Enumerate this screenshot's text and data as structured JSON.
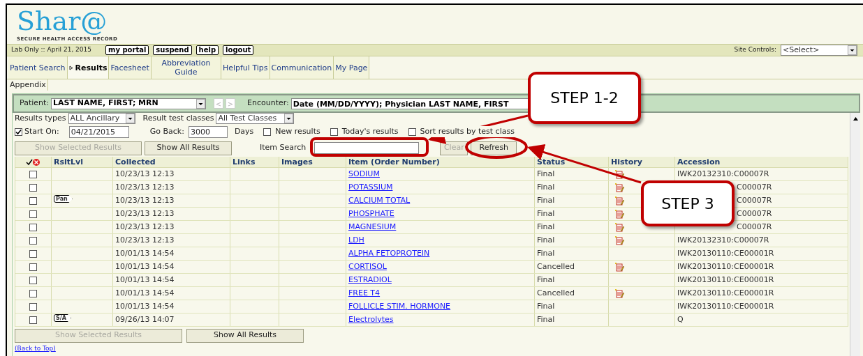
{
  "logo": {
    "title": "Shar@",
    "subtitle": "SECURE HEALTH ACCESS RECORD"
  },
  "top_bar": {
    "context": "Lab Only :: April 21, 2015",
    "buttons": [
      "my portal",
      "suspend",
      "help",
      "logout"
    ],
    "site_controls_label": "Site Controls:",
    "site_controls_value": "<Select>"
  },
  "tabs": [
    {
      "label": "Patient Search",
      "selected": false
    },
    {
      "label": "Results",
      "selected": true
    },
    {
      "label": "Facesheet",
      "selected": false
    },
    {
      "label": "Abbreviation Guide",
      "selected": false
    },
    {
      "label": "Helpful Tips",
      "selected": false
    },
    {
      "label": "Communication",
      "selected": false
    },
    {
      "label": "My Page",
      "selected": false
    }
  ],
  "tabs_row_2": [
    {
      "label": "Appendix",
      "selected": false
    }
  ],
  "patient_bar": {
    "patient_label": "Patient:",
    "patient_value": "LAST NAME, FIRST; MRN",
    "prev": {
      "label": "<",
      "disabled": true
    },
    "next": {
      "label": ">",
      "disabled": true
    },
    "encounter_label": "Encounter:",
    "encounter_value": "Date (MM/DD/YYYY); Physician LAST NAME, FIRST"
  },
  "filters": {
    "results_types_label": "Results types",
    "results_types_value": "ALL Ancillary",
    "test_classes_label": "Result test classes",
    "test_classes_value": "All Test Classes",
    "start_on": {
      "label": "Start On:",
      "checked": true,
      "value": "04/21/2015"
    },
    "go_back": {
      "label": "Go Back:",
      "value": "3000",
      "unit": "Days"
    },
    "options": [
      {
        "label": "New results",
        "checked": false
      },
      {
        "label": "Today's results",
        "checked": false
      },
      {
        "label": "Sort results by test class",
        "checked": false
      }
    ]
  },
  "actions": {
    "show_selected": {
      "label": "Show Selected Results",
      "disabled": true
    },
    "show_all": {
      "label": "Show All Results",
      "disabled": false
    },
    "item_search_label": "Item Search",
    "clear": {
      "label": "Clear",
      "disabled": true
    },
    "refresh": {
      "label": "Refresh",
      "disabled": false
    }
  },
  "table": {
    "columns": [
      "RsltLvl",
      "Collected",
      "Links",
      "Images",
      "Item (Order Number)",
      "Status",
      "History",
      "Accession"
    ],
    "rows": [
      {
        "checked": false,
        "level": "",
        "collected": "10/23/13 12:13",
        "item": "SODIUM",
        "status": "Final",
        "history": true,
        "accession": "IWK20132310:C00007R",
        "covered": false
      },
      {
        "checked": false,
        "level": "",
        "collected": "10/23/13 12:13",
        "item": "POTASSIUM",
        "status": "Final",
        "history": true,
        "accession": "C00007R",
        "covered": true
      },
      {
        "checked": false,
        "level": "Pan",
        "collected": "10/23/13 12:13",
        "item": "CALCIUM TOTAL",
        "status": "Final",
        "history": true,
        "accession": "C00007R",
        "covered": true
      },
      {
        "checked": false,
        "level": "",
        "collected": "10/23/13 12:13",
        "item": "PHOSPHATE",
        "status": "Final",
        "history": true,
        "accession": "C00007R",
        "covered": true
      },
      {
        "checked": false,
        "level": "",
        "collected": "10/23/13 12:13",
        "item": "MAGNESIUM",
        "status": "Final",
        "history": true,
        "accession": "C00007R",
        "covered": true
      },
      {
        "checked": false,
        "level": "",
        "collected": "10/23/13 12:13",
        "item": "LDH",
        "status": "Final",
        "history": true,
        "accession": "IWK20132310:C00007R",
        "covered": false
      },
      {
        "checked": false,
        "level": "",
        "collected": "10/01/13 14:54",
        "item": "ALPHA FETOPROTEIN",
        "status": "Final",
        "history": false,
        "accession": "IWK20130110:CE00001R",
        "covered": false
      },
      {
        "checked": false,
        "level": "",
        "collected": "10/01/13 14:54",
        "item": "CORTISOL",
        "status": "Cancelled",
        "history": true,
        "accession": "IWK20130110:CE00001R",
        "covered": false
      },
      {
        "checked": false,
        "level": "",
        "collected": "10/01/13 14:54",
        "item": "ESTRADIOL",
        "status": "Final",
        "history": false,
        "accession": "IWK20130110:CE00001R",
        "covered": false
      },
      {
        "checked": false,
        "level": "",
        "collected": "10/01/13 14:54",
        "item": "FREE T4",
        "status": "Cancelled",
        "history": true,
        "accession": "IWK20130110:CE00001R",
        "covered": false
      },
      {
        "checked": false,
        "level": "",
        "collected": "10/01/13 14:54",
        "item": "FOLLICLE STIM. HORMONE",
        "status": "Final",
        "history": false,
        "accession": "IWK20130110:CE00001R",
        "covered": false
      },
      {
        "checked": false,
        "level": "S/A",
        "collected": "09/26/13 14:07",
        "item": "Electrolytes",
        "status": "Final",
        "history": false,
        "accession": "Q",
        "covered": false
      }
    ]
  },
  "bottom_actions": {
    "show_selected": {
      "label": "Show Selected Results",
      "disabled": true
    },
    "show_all": {
      "label": "Show All Results",
      "disabled": false
    }
  },
  "back_to_top": "(Back to Top)",
  "callouts": [
    {
      "label": "STEP 1-2"
    },
    {
      "label": "STEP 3"
    }
  ]
}
